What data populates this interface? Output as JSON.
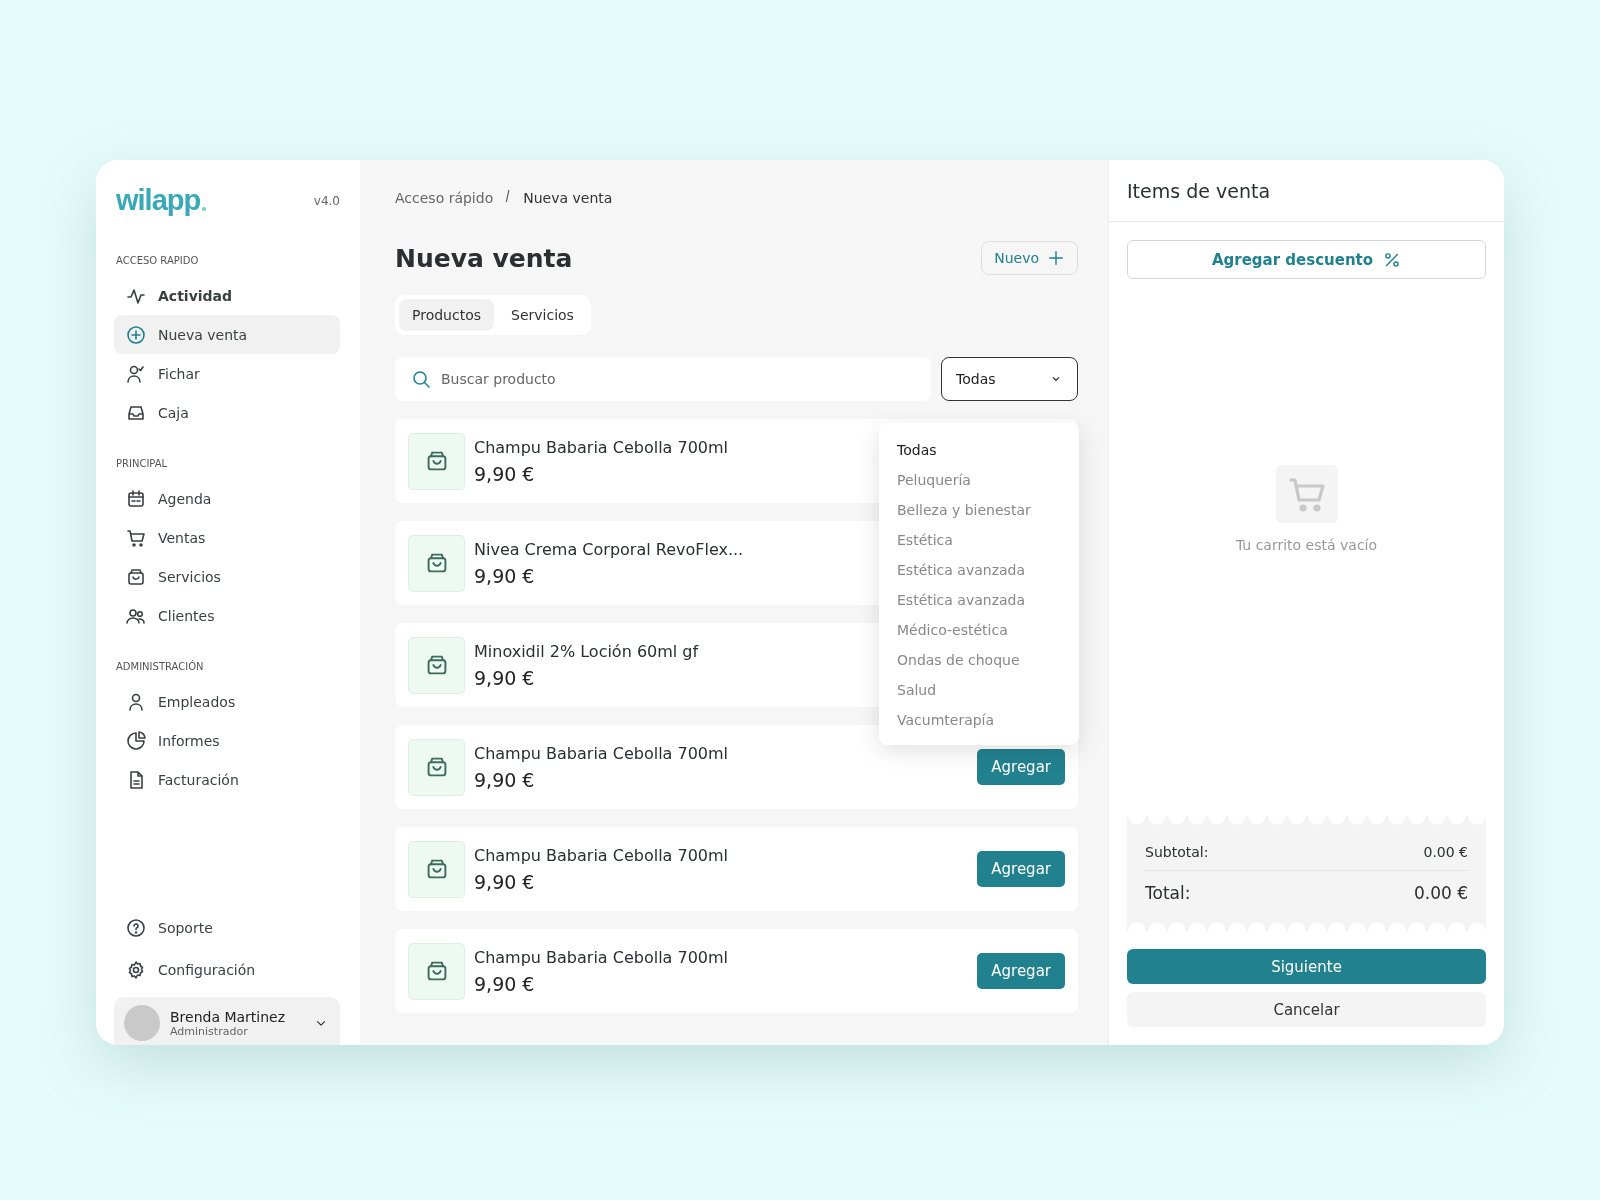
{
  "sidebar": {
    "logo": "wilapp",
    "version": "v4.0",
    "sections": [
      {
        "title": "ACCESO RAPIDO",
        "items": [
          {
            "label": "Actividad",
            "selected": false,
            "bold": true
          },
          {
            "label": "Nueva venta",
            "selected": true
          },
          {
            "label": "Fichar",
            "selected": false
          },
          {
            "label": "Caja",
            "selected": false
          }
        ]
      },
      {
        "title": "PRINCIPAL",
        "items": [
          {
            "label": "Agenda",
            "selected": false
          },
          {
            "label": "Ventas",
            "selected": false
          },
          {
            "label": "Servicios",
            "selected": false
          },
          {
            "label": "Clientes",
            "selected": false
          }
        ]
      },
      {
        "title": "ADMINISTRACIÓN",
        "items": [
          {
            "label": "Empleados",
            "selected": false
          },
          {
            "label": "Informes",
            "selected": false
          },
          {
            "label": "Facturación",
            "selected": false
          }
        ]
      }
    ],
    "footer_items": [
      {
        "label": "Soporte"
      },
      {
        "label": "Configuración"
      }
    ],
    "user": {
      "name": "Brenda Martinez",
      "role": "Administrador"
    }
  },
  "main": {
    "breadcrumb": [
      "Acceso rápido",
      "Nueva venta"
    ],
    "title": "Nueva venta",
    "new_button": "Nuevo",
    "tabs": [
      {
        "label": "Productos",
        "selected": true
      },
      {
        "label": "Servicios",
        "selected": false
      }
    ],
    "search": {
      "placeholder": "Buscar producto"
    },
    "category_select": {
      "value": "Todas",
      "expanded": true,
      "options": [
        {
          "label": "Todas",
          "selected": true
        },
        {
          "label": "Peluquería",
          "selected": false
        },
        {
          "label": "Belleza y bienestar",
          "selected": false
        },
        {
          "label": "Estética",
          "selected": false
        },
        {
          "label": "Estética avanzada",
          "selected": false
        },
        {
          "label": "Estética avanzada",
          "selected": false
        },
        {
          "label": "Médico-estética",
          "selected": false
        },
        {
          "label": "Ondas de choque",
          "selected": false
        },
        {
          "label": "Salud",
          "selected": false
        },
        {
          "label": "Vacumterapía",
          "selected": false
        }
      ]
    },
    "products": [
      {
        "name": "Champu Babaria Cebolla 700ml",
        "price": "9,90 €"
      },
      {
        "name": "Nivea Crema Corporal RevoFlex...",
        "price": "9,90 €"
      },
      {
        "name": "Minoxidil 2% Loción 60ml gf",
        "price": "9,90 €"
      },
      {
        "name": "Champu Babaria Cebolla 700ml",
        "price": "9,90 €",
        "button": "Agregar"
      },
      {
        "name": "Champu Babaria Cebolla 700ml",
        "price": "9,90 €",
        "button": "Agregar"
      },
      {
        "name": "Champu Babaria Cebolla 700ml",
        "price": "9,90 €",
        "button": "Agregar"
      }
    ]
  },
  "cart": {
    "title": "Items de venta",
    "discount_button": "Agregar descuento",
    "empty_text": "Tu carrito está vacío",
    "subtotal": {
      "label": "Subtotal:",
      "value": "0.00 €"
    },
    "total": {
      "label": "Total:",
      "value": "0.00 €"
    },
    "primary_button": "Siguiente",
    "cancel_button": "Cancelar"
  }
}
